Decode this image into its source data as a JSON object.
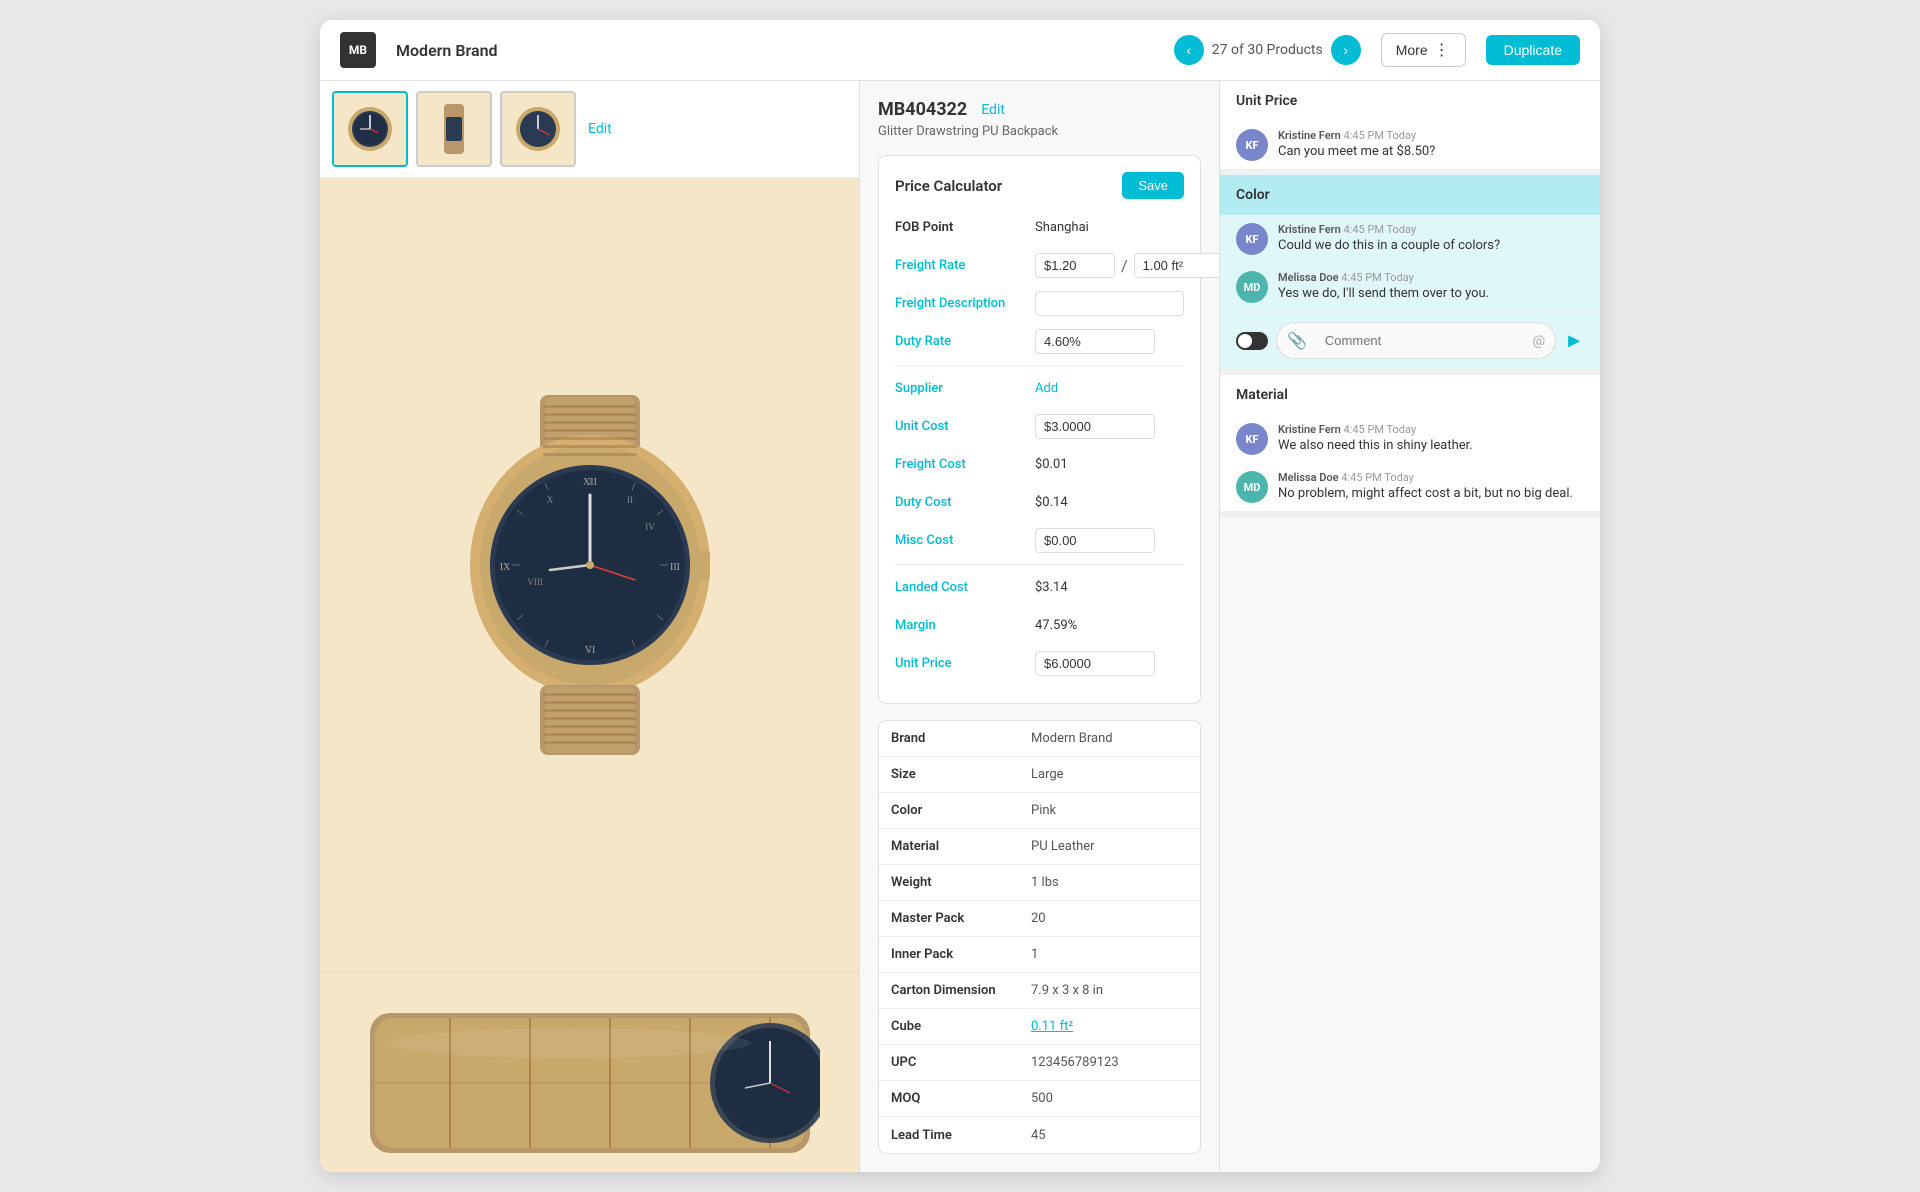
{
  "brand": {
    "logo": "MB",
    "name": "Modern Brand"
  },
  "navigation": {
    "current": 27,
    "total": 30,
    "label": "27 of 30 Products",
    "more_label": "More",
    "duplicate_label": "Duplicate"
  },
  "product": {
    "id": "MB404322",
    "edit_label": "Edit",
    "name": "Glitter Drawstring PU Backpack"
  },
  "price_calculator": {
    "title": "Price Calculator",
    "save_label": "Save",
    "fob_point_label": "FOB Point",
    "fob_point_value": "Shanghai",
    "freight_rate_label": "Freight Rate",
    "freight_rate_value": "$1.20",
    "freight_rate_unit": "1.00 ft²",
    "freight_desc_label": "Freight Description",
    "freight_desc_value": "",
    "duty_rate_label": "Duty Rate",
    "duty_rate_value": "4.60%",
    "supplier_label": "Supplier",
    "add_label": "Add",
    "unit_cost_label": "Unit Cost",
    "unit_cost_value": "$3.0000",
    "freight_cost_label": "Freight Cost",
    "freight_cost_value": "$0.01",
    "duty_cost_label": "Duty Cost",
    "duty_cost_value": "$0.14",
    "misc_cost_label": "Misc Cost",
    "misc_cost_value": "$0.00",
    "landed_cost_label": "Landed Cost",
    "landed_cost_value": "$3.14",
    "margin_label": "Margin",
    "margin_value": "47.59%",
    "unit_price_label": "Unit Price",
    "unit_price_value": "$6.0000"
  },
  "specs": [
    {
      "label": "Brand",
      "value": "Modern Brand",
      "link": false
    },
    {
      "label": "Size",
      "value": "Large",
      "link": false
    },
    {
      "label": "Color",
      "value": "Pink",
      "link": false
    },
    {
      "label": "Material",
      "value": "PU Leather",
      "link": false
    },
    {
      "label": "Weight",
      "value": "1 lbs",
      "link": false
    },
    {
      "label": "Master Pack",
      "value": "20",
      "link": false
    },
    {
      "label": "Inner Pack",
      "value": "1",
      "link": false
    },
    {
      "label": "Carton Dimension",
      "value": "7.9 x 3 x 8 in",
      "link": false
    },
    {
      "label": "Cube",
      "value": "0.11 ft²",
      "link": true
    },
    {
      "label": "UPC",
      "value": "123456789123",
      "link": false
    },
    {
      "label": "MOQ",
      "value": "500",
      "link": false
    },
    {
      "label": "Lead Time",
      "value": "45",
      "link": false
    }
  ],
  "comments": {
    "unit_price_section": {
      "title": "Unit Price",
      "messages": [
        {
          "author": "Kristine Fern",
          "initials": "KF",
          "time": "4:45 PM Today",
          "text": "Can you meet me at $8.50?"
        }
      ]
    },
    "color_section": {
      "title": "Color",
      "active": true,
      "messages": [
        {
          "author": "Kristine Fern",
          "initials": "KF",
          "time": "4:45 PM Today",
          "text": "Could we do this in a couple of colors?"
        },
        {
          "author": "Melissa Doe",
          "initials": "MD",
          "time": "4:45 PM Today",
          "text": "Yes we do, I'll send them over to you."
        }
      ],
      "comment_placeholder": "Comment"
    },
    "material_section": {
      "title": "Material",
      "messages": [
        {
          "author": "Kristine Fern",
          "initials": "KF",
          "time": "4:45 PM Today",
          "text": "We also need this in shiny leather."
        },
        {
          "author": "Melissa Doe",
          "initials": "MD",
          "time": "4:45 PM Today",
          "text": "No problem, might affect cost a bit, but no big deal."
        }
      ]
    }
  }
}
